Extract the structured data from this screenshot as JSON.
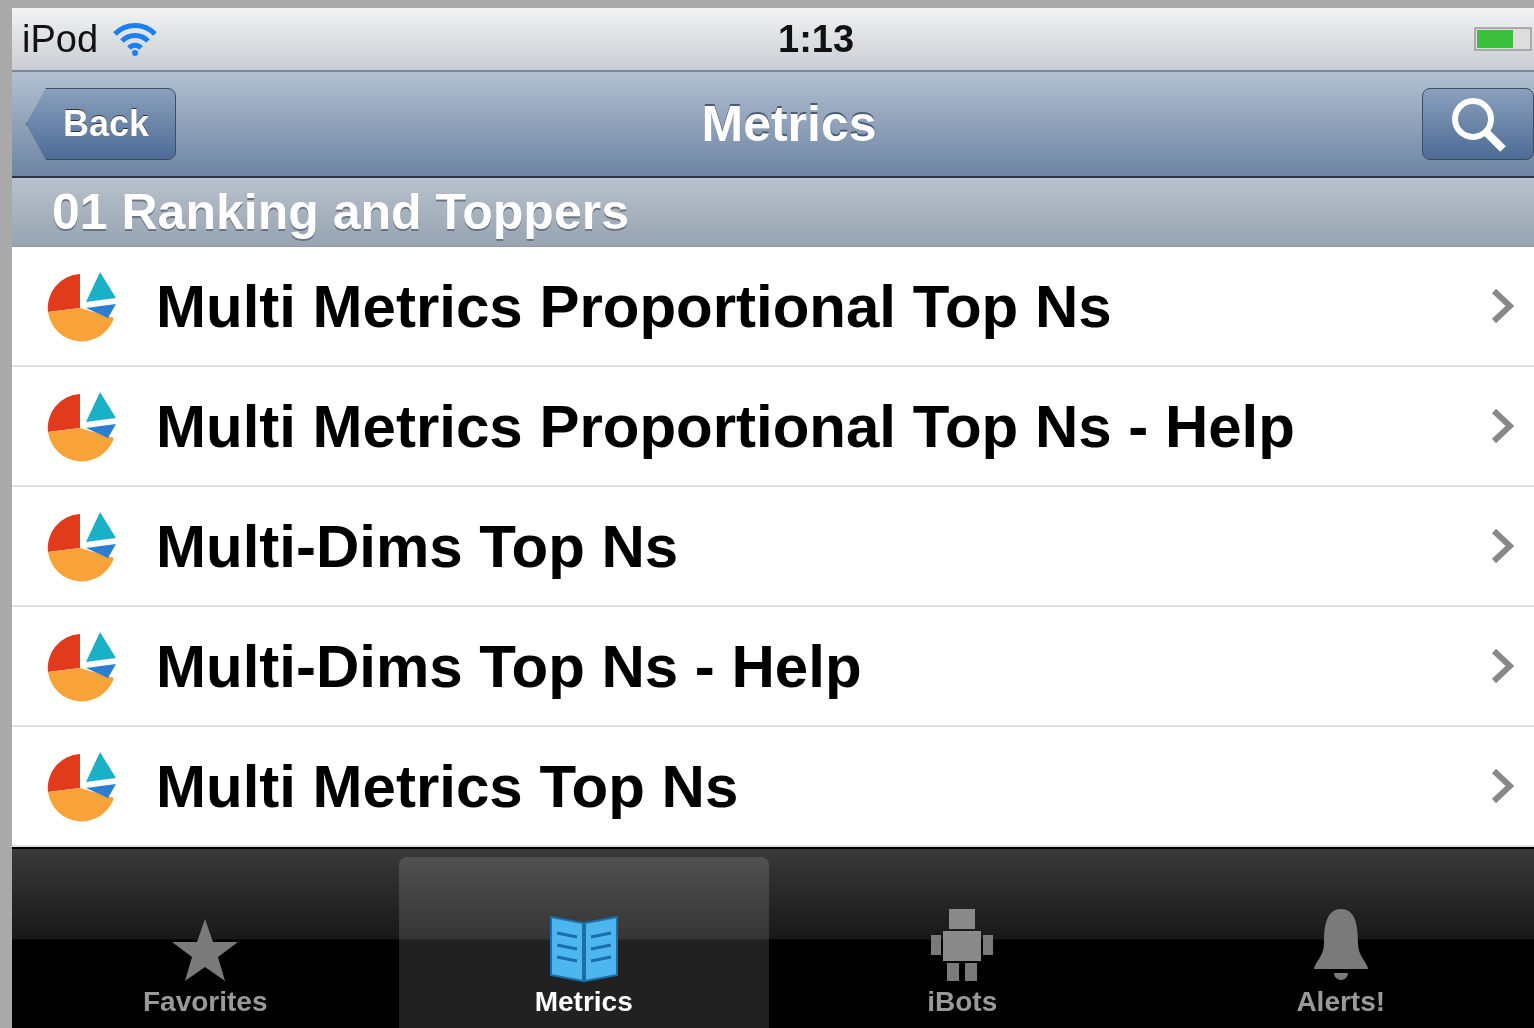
{
  "status_bar": {
    "device": "iPod",
    "time": "1:13"
  },
  "nav_bar": {
    "back": "Back",
    "title": "Metrics"
  },
  "section": {
    "title": "01 Ranking and Toppers"
  },
  "rows": [
    {
      "label": "Multi Metrics Proportional Top Ns"
    },
    {
      "label": "Multi Metrics Proportional Top Ns - Help"
    },
    {
      "label": "Multi-Dims Top Ns"
    },
    {
      "label": "Multi-Dims Top Ns - Help"
    },
    {
      "label": "Multi Metrics Top Ns"
    }
  ],
  "tabs": [
    {
      "label": "Favorites",
      "kind": "star",
      "selected": false
    },
    {
      "label": "Metrics",
      "kind": "book",
      "selected": true
    },
    {
      "label": "iBots",
      "kind": "robot",
      "selected": false
    },
    {
      "label": "Alerts!",
      "kind": "bell",
      "selected": false
    }
  ]
}
